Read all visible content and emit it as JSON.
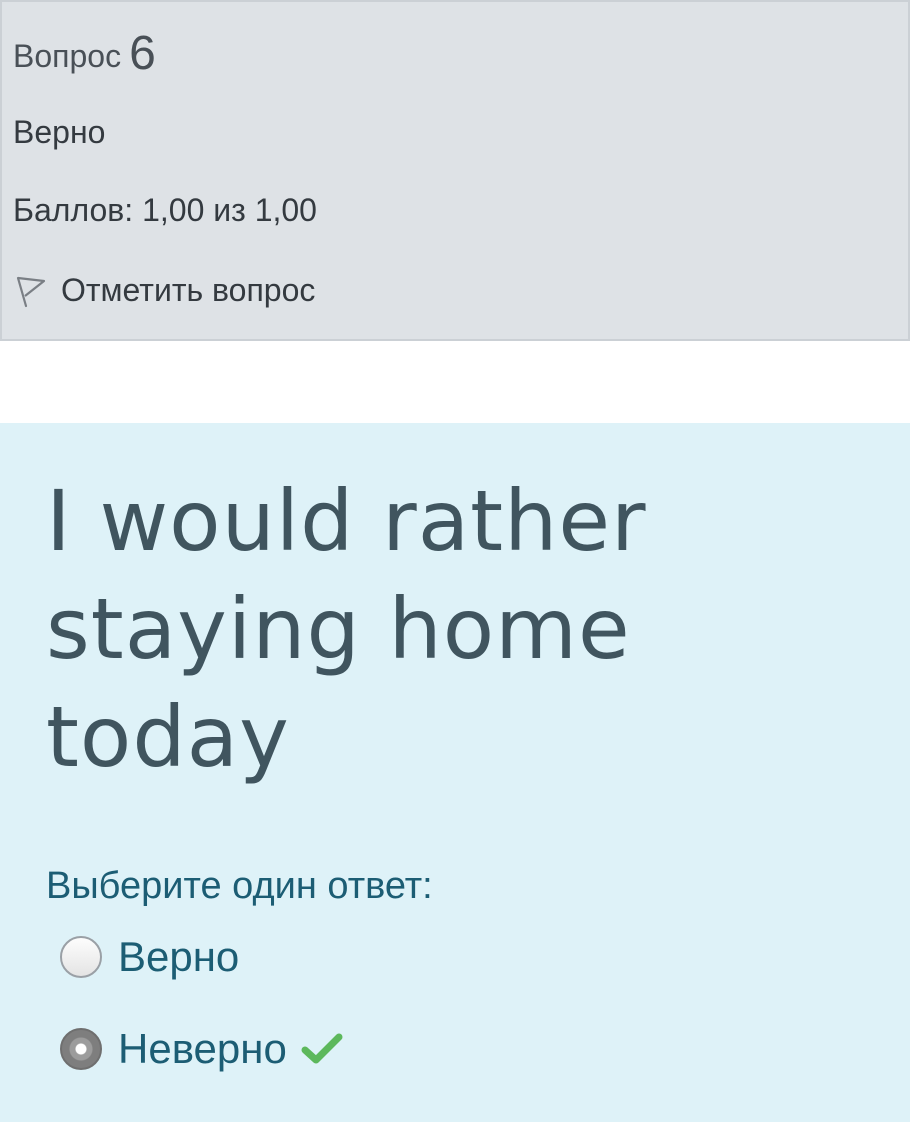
{
  "info": {
    "question_label": "Вопрос",
    "question_number": "6",
    "state": "Верно",
    "grade": "Баллов: 1,00 из 1,00",
    "flag_label": "Отметить вопрос"
  },
  "question": {
    "text": "I would rather staying home today",
    "prompt": "Выберите один ответ:",
    "options": [
      {
        "label": "Верно",
        "selected": false
      },
      {
        "label": "Неверно",
        "selected": true,
        "correct": true
      }
    ]
  },
  "colors": {
    "info_bg": "#dee2e6",
    "question_bg": "#def2f8",
    "correct_check": "#5cb85c",
    "text_teal": "#1c5d74"
  },
  "icons": [
    "flag-icon",
    "check-icon"
  ]
}
